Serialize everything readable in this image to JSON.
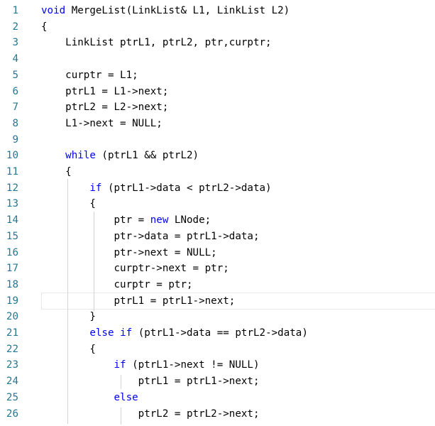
{
  "editor": {
    "lines": [
      {
        "num": "1",
        "tokens": [
          {
            "t": "void",
            "kw": true
          },
          {
            "t": " MergeList(LinkList& L1, LinkList L2)"
          }
        ]
      },
      {
        "num": "2",
        "tokens": [
          {
            "t": "{"
          }
        ]
      },
      {
        "num": "3",
        "tokens": [
          {
            "t": "    LinkList ptrL1, ptrL2, ptr,curptr;"
          }
        ]
      },
      {
        "num": "4",
        "tokens": []
      },
      {
        "num": "5",
        "tokens": [
          {
            "t": "    curptr = L1;"
          }
        ]
      },
      {
        "num": "6",
        "tokens": [
          {
            "t": "    ptrL1 = L1->next;"
          }
        ]
      },
      {
        "num": "7",
        "tokens": [
          {
            "t": "    ptrL2 = L2->next;"
          }
        ]
      },
      {
        "num": "8",
        "tokens": [
          {
            "t": "    L1->next = NULL;"
          }
        ]
      },
      {
        "num": "9",
        "tokens": []
      },
      {
        "num": "10",
        "tokens": [
          {
            "t": "    "
          },
          {
            "t": "while",
            "kw": true
          },
          {
            "t": " (ptrL1 && ptrL2)"
          }
        ]
      },
      {
        "num": "11",
        "tokens": [
          {
            "t": "    {"
          }
        ]
      },
      {
        "num": "12",
        "tokens": [
          {
            "t": "        "
          },
          {
            "t": "if",
            "kw": true
          },
          {
            "t": " (ptrL1->data < ptrL2->data)"
          }
        ]
      },
      {
        "num": "13",
        "tokens": [
          {
            "t": "        {"
          }
        ]
      },
      {
        "num": "14",
        "tokens": [
          {
            "t": "            ptr = "
          },
          {
            "t": "new",
            "kw": true
          },
          {
            "t": " LNode;"
          }
        ]
      },
      {
        "num": "15",
        "tokens": [
          {
            "t": "            ptr->data = ptrL1->data;"
          }
        ]
      },
      {
        "num": "16",
        "tokens": [
          {
            "t": "            ptr->next = NULL;"
          }
        ]
      },
      {
        "num": "17",
        "tokens": [
          {
            "t": "            curptr->next = ptr;"
          }
        ]
      },
      {
        "num": "18",
        "tokens": [
          {
            "t": "            curptr = ptr;"
          }
        ]
      },
      {
        "num": "19",
        "tokens": [
          {
            "t": "            ptrL1 = ptrL1->next;"
          }
        ]
      },
      {
        "num": "20",
        "tokens": [
          {
            "t": "        }"
          }
        ]
      },
      {
        "num": "21",
        "tokens": [
          {
            "t": "        "
          },
          {
            "t": "else",
            "kw": true
          },
          {
            "t": " "
          },
          {
            "t": "if",
            "kw": true
          },
          {
            "t": " (ptrL1->data == ptrL2->data)"
          }
        ]
      },
      {
        "num": "22",
        "tokens": [
          {
            "t": "        {"
          }
        ]
      },
      {
        "num": "23",
        "tokens": [
          {
            "t": "            "
          },
          {
            "t": "if",
            "kw": true
          },
          {
            "t": " (ptrL1->next != NULL)"
          }
        ]
      },
      {
        "num": "24",
        "tokens": [
          {
            "t": "                ptrL1 = ptrL1->next;"
          }
        ]
      },
      {
        "num": "25",
        "tokens": [
          {
            "t": "            "
          },
          {
            "t": "else",
            "kw": true
          }
        ]
      },
      {
        "num": "26",
        "tokens": [
          {
            "t": "                ptrL2 = ptrL2->next;"
          }
        ]
      }
    ],
    "current_line": "19"
  },
  "colors": {
    "keyword": "#0000ff",
    "line_number": "#237893",
    "text": "#000000",
    "indent_guide": "#d3d3d3",
    "current_line_border": "#e8e8e8",
    "background": "#ffffff"
  }
}
